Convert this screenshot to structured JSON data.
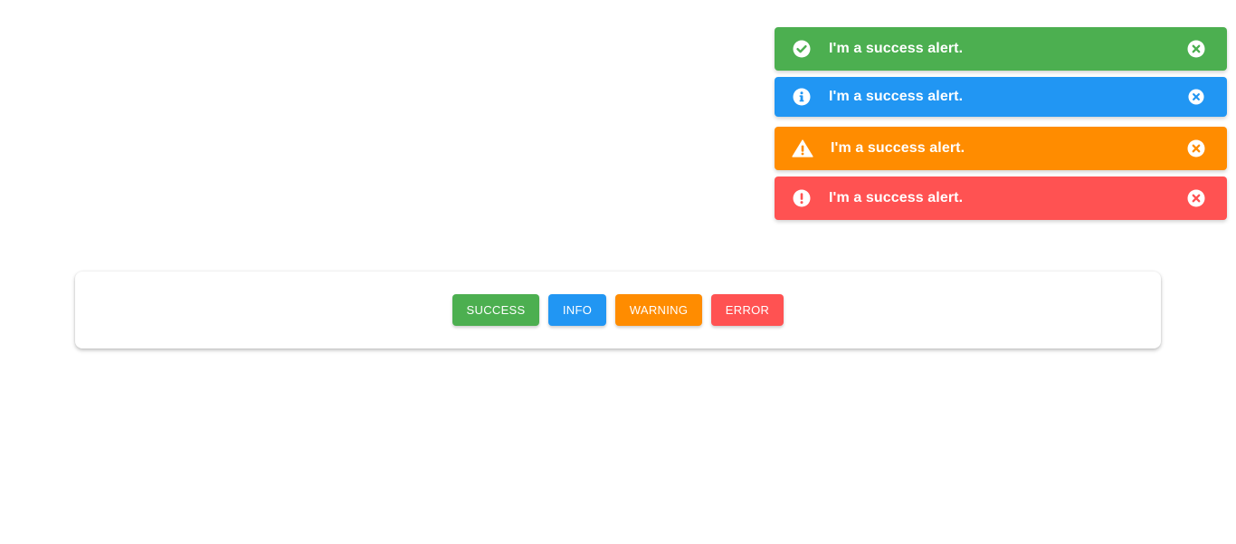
{
  "colors": {
    "success": "#4caf50",
    "info": "#2196f3",
    "warning": "#ff8c00",
    "error": "#ff5252"
  },
  "alerts": [
    {
      "type": "success",
      "icon": "check-circle-icon",
      "text": "I'm a success alert.",
      "close_icon": "close-circle-icon"
    },
    {
      "type": "info",
      "icon": "info-circle-icon",
      "text": "I'm a success alert.",
      "close_icon": "close-circle-icon"
    },
    {
      "type": "warning",
      "icon": "warning-triangle-icon",
      "text": "I'm a success alert.",
      "close_icon": "close-circle-icon"
    },
    {
      "type": "error",
      "icon": "exclamation-circle-icon",
      "text": "I'm a success alert.",
      "close_icon": "close-circle-icon"
    }
  ],
  "buttons": {
    "success": "SUCCESS",
    "info": "INFO",
    "warning": "WARNING",
    "error": "ERROR"
  }
}
